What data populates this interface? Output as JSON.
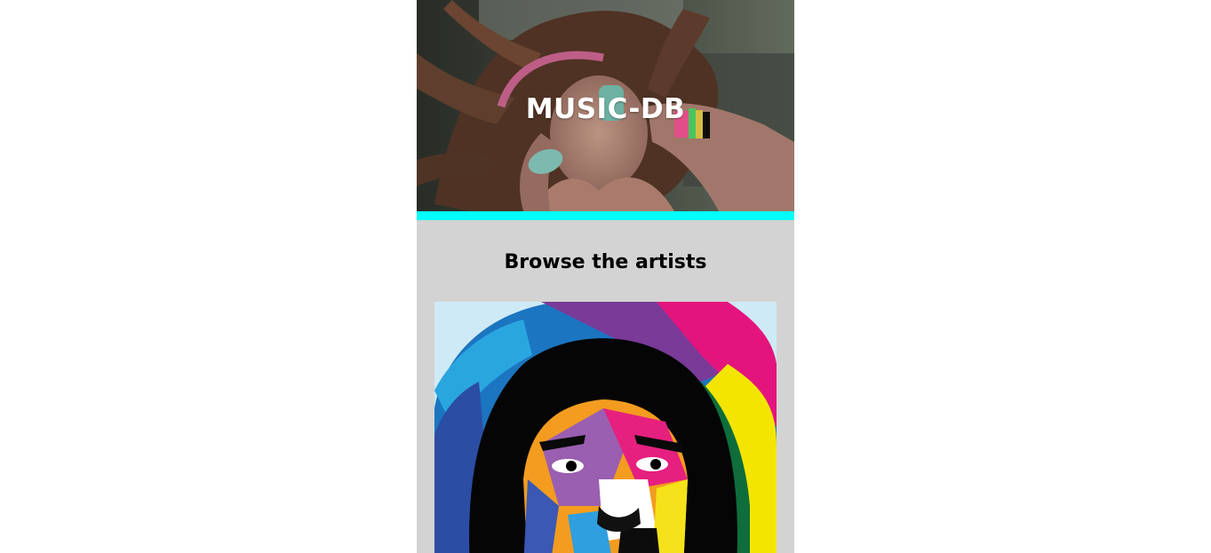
{
  "header": {
    "title": "MUSIC-DB",
    "background": "photo of a person wearing headphones with flowing hair",
    "accent_color": "#00ffff"
  },
  "main": {
    "section_title": "Browse the artists",
    "artists": [
      {
        "image": "colorful low-poly pop-art portrait of an artist with voluminous hair"
      }
    ]
  },
  "colors": {
    "page_background": "#ffffff",
    "content_background": "#d3d3d3",
    "accent_bar": "#00ffff",
    "title_text": "#ffffff"
  }
}
